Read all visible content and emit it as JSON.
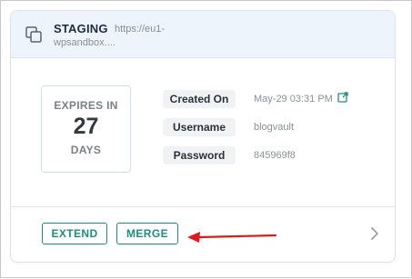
{
  "site": {
    "environment": "STAGING",
    "url_line1": "https://eu1-",
    "url_line2": "wpsandbox...."
  },
  "expiry": {
    "title": "EXPIRES IN",
    "value": "27",
    "unit": "DAYS"
  },
  "details": [
    {
      "label": "Created On",
      "value": "May-29 03:31 PM"
    },
    {
      "label": "Username",
      "value": "blogvault"
    },
    {
      "label": "Password",
      "value": "845969f8"
    }
  ],
  "actions": {
    "extend_label": "EXTEND",
    "merge_label": "MERGE"
  },
  "colors": {
    "accent": "#1a8f7d",
    "header_bg": "#eef4fb",
    "annotation_arrow": "#e0191b"
  },
  "icons": {
    "site": "staging-copy-icon",
    "created_link": "external-link-icon",
    "more": "chevron-right-icon",
    "annotation": "red-arrow-icon"
  }
}
